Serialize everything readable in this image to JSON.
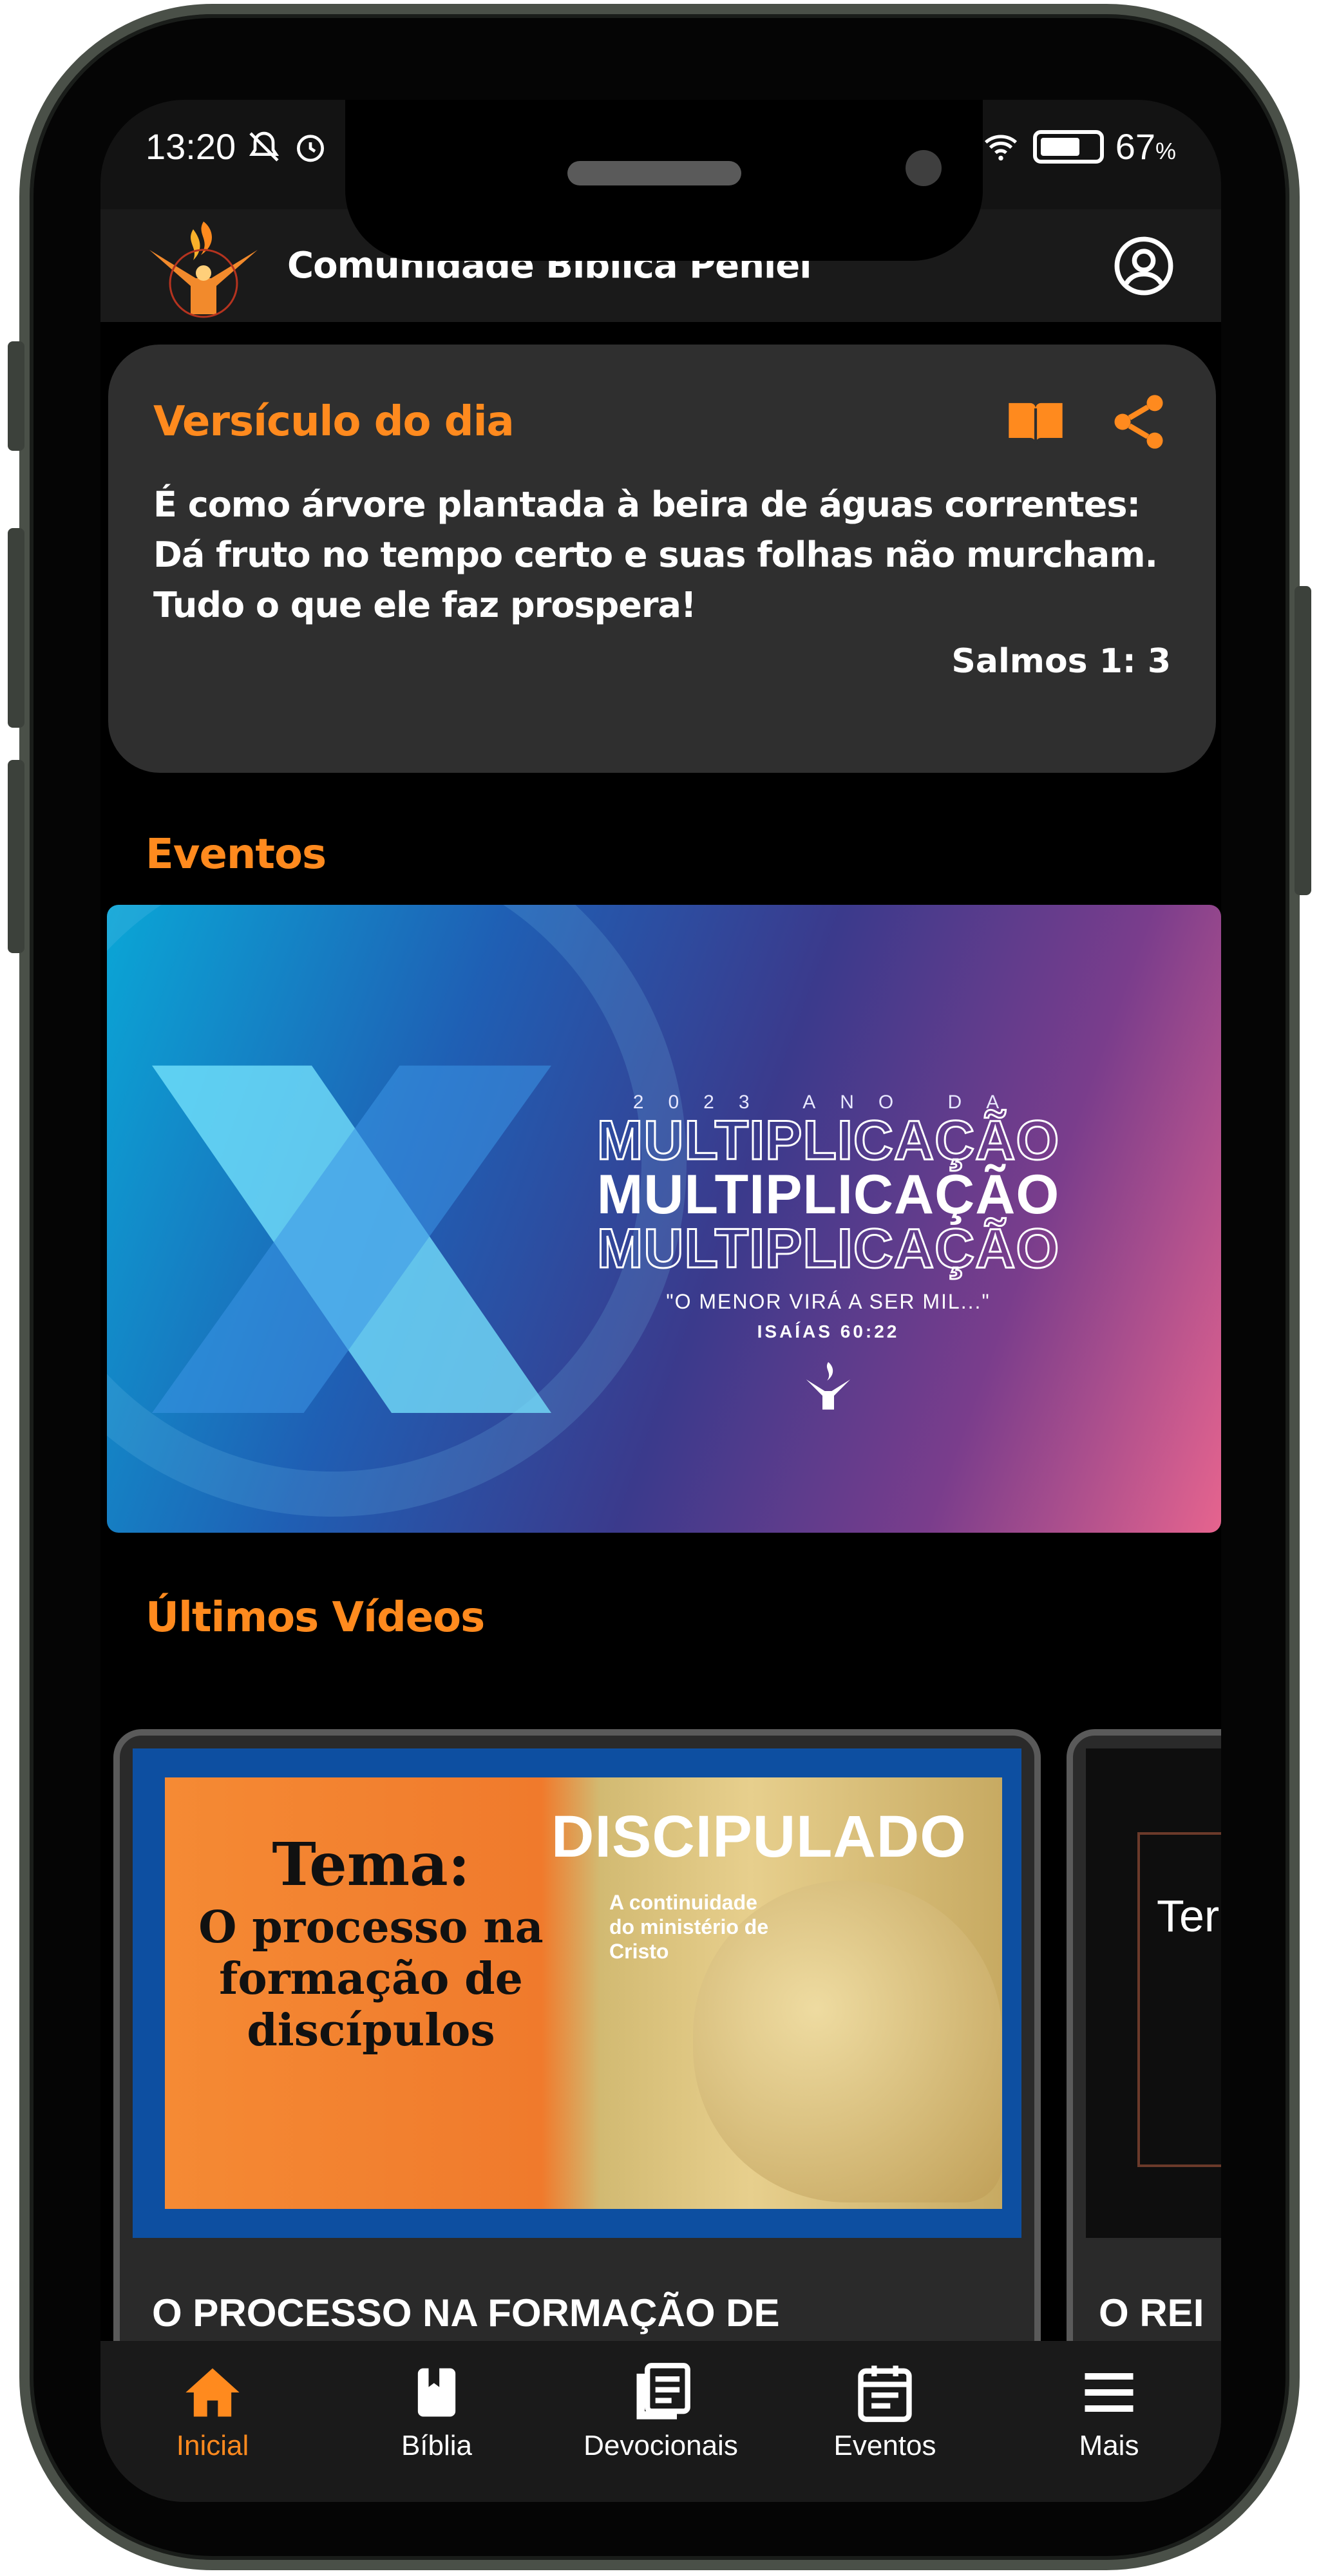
{
  "status_bar": {
    "time": "13:20",
    "battery": "67",
    "battery_unit": "%"
  },
  "app_bar": {
    "title": "Comunidade Bíblica Peniel",
    "logo_icon": "church-logo-icon",
    "profile_icon": "profile-icon"
  },
  "verse": {
    "title": "Versículo do dia",
    "text": "É como árvore plantada à beira de águas correntes: Dá fruto no tempo certo e suas folhas não murcham. Tudo o que ele faz prospera!",
    "reference": "Salmos 1: 3",
    "icons": [
      "book-icon",
      "share-icon"
    ]
  },
  "sections": {
    "events": "Eventos",
    "videos": "Últimos Vídeos"
  },
  "event_banner": {
    "year_line": "2023 ANO DA",
    "word": "MULTIPLICAÇÃO",
    "quote": "\"O MENOR VIRÁ A SER MIL...\"",
    "reference": "ISAÍAS 60:22",
    "ring_text": "ANO DA MULTIPLICAÇÃO"
  },
  "videos": [
    {
      "title": "O PROCESSO NA FORMAÇÃO DE DISCIPULOS  - PASTOR ENOQUE DANTAS",
      "thumb_tema": "Tema:",
      "thumb_sub": "O processo na formação de discípulos",
      "thumb_heading": "DISCIPULADO",
      "thumb_caption": "A continuidade do ministério de Cristo"
    },
    {
      "title": "O REI ENOQ",
      "thumb_text": "Ter"
    }
  ],
  "bottom_nav": [
    {
      "label": "Inicial",
      "icon": "home-icon",
      "active": true
    },
    {
      "label": "Bíblia",
      "icon": "bible-icon",
      "active": false
    },
    {
      "label": "Devocionais",
      "icon": "devotionals-icon",
      "active": false
    },
    {
      "label": "Eventos",
      "icon": "calendar-icon",
      "active": false
    },
    {
      "label": "Mais",
      "icon": "menu-icon",
      "active": false
    }
  ],
  "colors": {
    "accent": "#ff8a1e",
    "background": "#000000",
    "card": "#2f2f2f",
    "appbar": "#1a1a1a"
  }
}
